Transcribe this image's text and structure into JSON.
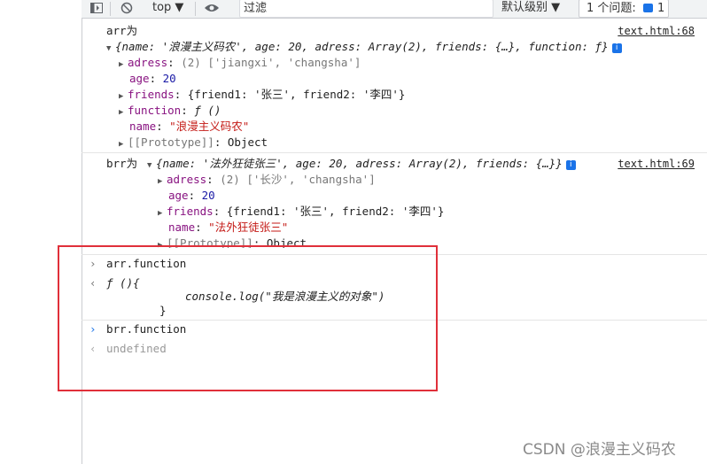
{
  "toolbar": {
    "context": "top ▼",
    "filter_value": "过滤",
    "levels": "默认级别 ▼",
    "issues_label": "1 个问题:",
    "issues_count": "1"
  },
  "log1": {
    "label": "arr为",
    "source": "text.html:68",
    "summary": "{name: '浪漫主义码农', age: 20, adress: Array(2), friends: {…}, function: ƒ}",
    "info": "i",
    "rows": [
      {
        "key": "adress",
        "value": "(2) ['jiangxi', 'changsha']"
      },
      {
        "key": "age",
        "value": "20"
      },
      {
        "key": "friends",
        "value": "{friend1: '张三', friend2: '李四'}"
      },
      {
        "key": "function",
        "value": "ƒ ()"
      },
      {
        "key": "name",
        "value": "\"浪漫主义码农\""
      },
      {
        "key": "[[Prototype]]",
        "value": "Object"
      }
    ]
  },
  "log2": {
    "label": "brr为",
    "source": "text.html:69",
    "summary": "{name: '法外狂徒张三', age: 20, adress: Array(2), friends: {…}}",
    "info": "i",
    "rows": [
      {
        "key": "adress",
        "value": "(2) ['长沙', 'changsha']"
      },
      {
        "key": "age",
        "value": "20"
      },
      {
        "key": "friends",
        "value": "{friend1: '张三', friend2: '李四'}"
      },
      {
        "key": "name",
        "value": "\"法外狂徒张三\""
      },
      {
        "key": "[[Prototype]]",
        "value": "Object"
      }
    ]
  },
  "cmd1": {
    "input": "arr.function",
    "out_line1": "ƒ (){",
    "out_line2": "console.log(\"我是浪漫主义的对象\")",
    "out_line3": "}"
  },
  "cmd2": {
    "input": "brr.function",
    "output": "undefined"
  },
  "watermark": "CSDN @浪漫主义码农"
}
